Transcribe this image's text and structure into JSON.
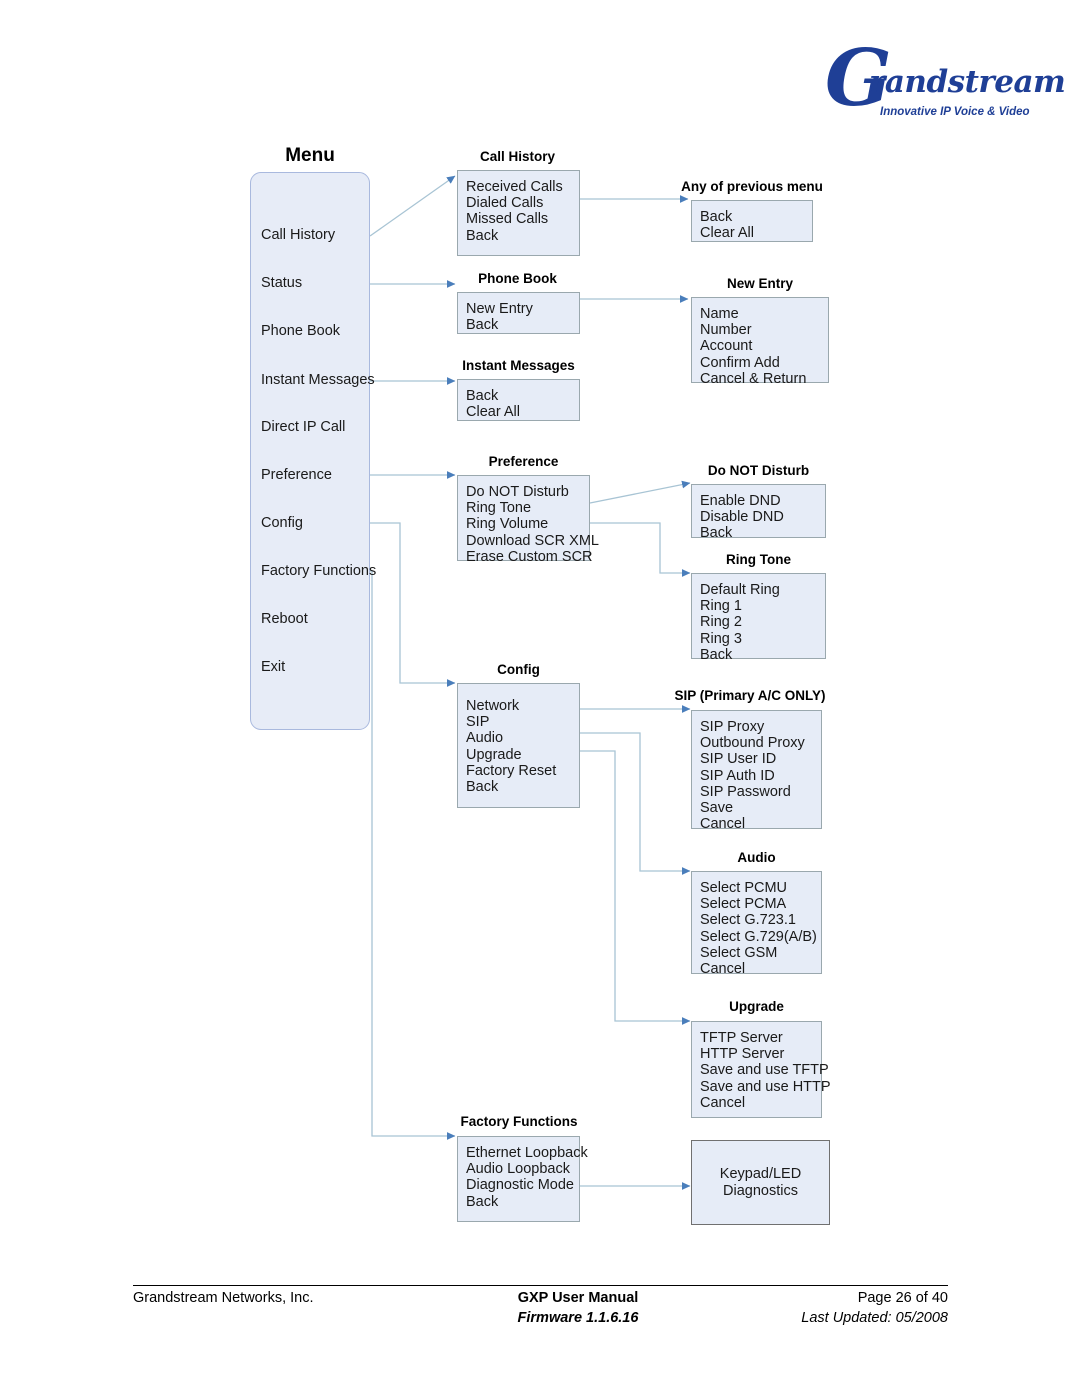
{
  "logo": {
    "mark": "G",
    "name": "randstream",
    "tagline": "Innovative IP Voice & Video"
  },
  "diagram": {
    "title": "Menu",
    "menu": {
      "caption": "Menu",
      "items": [
        "Call History",
        "Status",
        "Phone Book",
        "Instant Messages",
        "Direct IP Call",
        "Preference",
        "Config",
        "Factory Functions",
        "Reboot",
        "Exit"
      ]
    },
    "nodes": [
      {
        "id": "call-history",
        "caption": "Call History",
        "items": [
          "Received Calls",
          "Dialed Calls",
          "Missed Calls",
          "Back"
        ]
      },
      {
        "id": "any-previous-menu",
        "caption": "Any of previous menu",
        "items": [
          "Back",
          "Clear All"
        ]
      },
      {
        "id": "phone-book",
        "caption": "Phone Book",
        "items": [
          "New Entry",
          "Back"
        ]
      },
      {
        "id": "new-entry",
        "caption": "New Entry",
        "items": [
          "Name",
          "Number",
          "Account",
          "Confirm Add",
          "Cancel & Return"
        ]
      },
      {
        "id": "instant-messages",
        "caption": "Instant Messages",
        "items": [
          "Back",
          "Clear All"
        ]
      },
      {
        "id": "preference",
        "caption": "Preference",
        "items": [
          "Do NOT Disturb",
          "Ring Tone",
          "Ring Volume",
          "Download SCR XML",
          "Erase Custom SCR"
        ]
      },
      {
        "id": "do-not-disturb",
        "caption": "Do NOT Disturb",
        "items": [
          "Enable DND",
          "Disable DND",
          "Back"
        ]
      },
      {
        "id": "ring-tone",
        "caption": "Ring Tone",
        "items": [
          "Default Ring",
          "Ring 1",
          "Ring 2",
          "Ring 3",
          "Back"
        ]
      },
      {
        "id": "config",
        "caption": "Config",
        "items": [
          "Network",
          "SIP",
          "Audio",
          "Upgrade",
          "Factory Reset",
          "Back"
        ]
      },
      {
        "id": "sip",
        "caption": "SIP (Primary A/C ONLY)",
        "items": [
          "SIP Proxy",
          "Outbound Proxy",
          "SIP User ID",
          "SIP Auth ID",
          "SIP Password",
          "Save",
          "Cancel"
        ]
      },
      {
        "id": "audio",
        "caption": "Audio",
        "items": [
          "Select PCMU",
          "Select PCMA",
          "Select G.723.1",
          "Select G.729(A/B)",
          "Select GSM",
          "Cancel"
        ]
      },
      {
        "id": "upgrade",
        "caption": "Upgrade",
        "items": [
          "TFTP Server",
          "HTTP Server",
          "Save and use TFTP",
          "Save and use HTTP",
          "Cancel"
        ]
      },
      {
        "id": "factory-functions",
        "caption": "Factory Functions",
        "items": [
          "Ethernet Loopback",
          "Audio Loopback",
          "Diagnostic Mode",
          "Back"
        ]
      },
      {
        "id": "keypad-led",
        "caption": "",
        "items": [
          "Keypad/LED",
          "Diagnostics"
        ]
      }
    ]
  },
  "footer": {
    "company": "Grandstream Networks, Inc.",
    "manual": "GXP User Manual",
    "firmware": "Firmware 1.1.6.16",
    "page": "Page 26 of 40",
    "updated": "Last Updated:  05/2008"
  },
  "colors": {
    "box_fill": "#e6ecf7",
    "box_border": "#9aa8ae",
    "connector": "#a8c4d4",
    "arrow": "#4a7ebb",
    "brand": "#1f3f96"
  }
}
